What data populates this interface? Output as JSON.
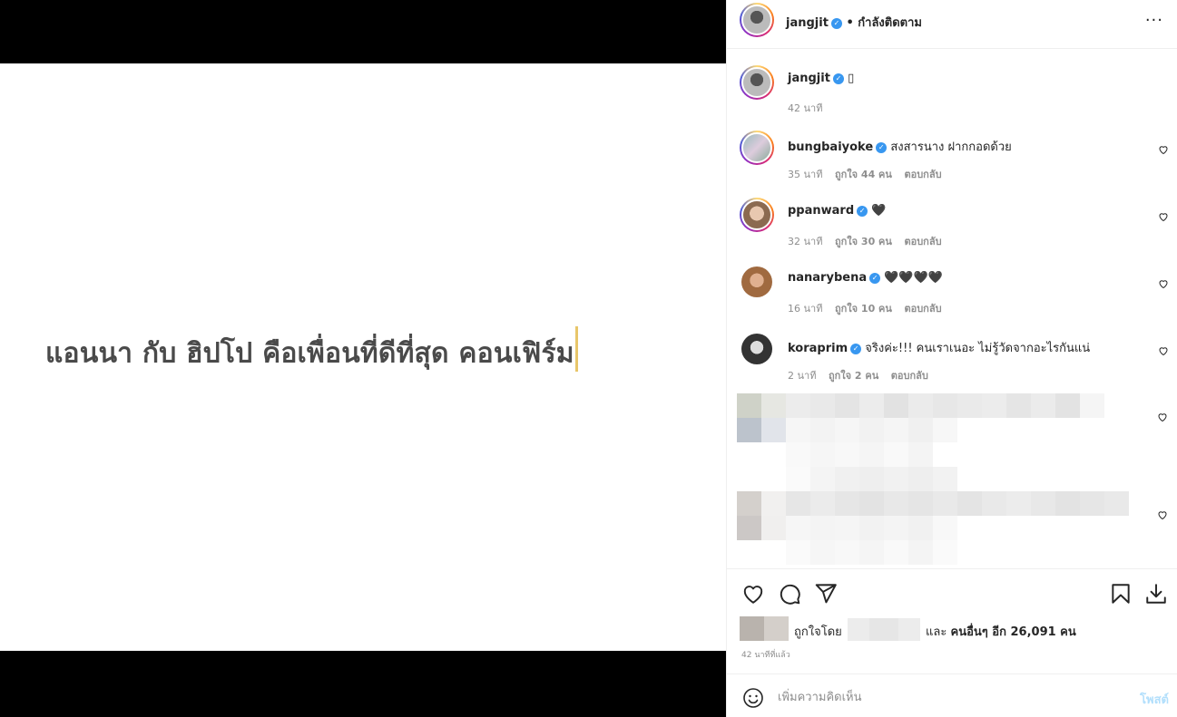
{
  "media": {
    "caption": "แอนนา กับ ฮิปโป คือเพื่อนที่ดีที่สุด คอนเฟิร์ม"
  },
  "header": {
    "username": "jangjit",
    "separator": "•",
    "follow_status": "กำลังติดตาม",
    "more": "···"
  },
  "caption_comment": {
    "username": "jangjit",
    "text": "▯",
    "time": "42 นาที"
  },
  "comments": [
    {
      "username": "bungbaiyoke",
      "text": "สงสารนาง ฝากกอดด้วย",
      "time": "35 นาที",
      "likes": "ถูกใจ 44 คน",
      "reply": "ตอบกลับ"
    },
    {
      "username": "ppanward",
      "text": "🖤",
      "time": "32 นาที",
      "likes": "ถูกใจ 30 คน",
      "reply": "ตอบกลับ"
    },
    {
      "username": "nanarybena",
      "text": "🖤🖤🖤🖤",
      "time": "16 นาที",
      "likes": "ถูกใจ 10 คน",
      "reply": "ตอบกลับ"
    },
    {
      "username": "koraprim",
      "text": "จริงค่ะ!!! คนเราเนอะ ไม่รู้วัดจากอะไรกันแน่",
      "time": "2 นาที",
      "likes": "ถูกใจ 2 คน",
      "reply": "ตอบกลับ"
    }
  ],
  "likes": {
    "prefix": "ถูกใจโดย",
    "and": "และ",
    "others": "คนอื่นๆ อีก 26,091 คน"
  },
  "time_ago": "42 นาทีที่แล้ว",
  "add_comment": {
    "placeholder": "เพิ่มความคิดเห็น",
    "post": "โพสต์"
  },
  "icons": [
    "heart-icon",
    "comment-icon",
    "share-icon",
    "bookmark-icon",
    "download-icon",
    "emoji-icon",
    "more-icon",
    "verified-icon"
  ]
}
